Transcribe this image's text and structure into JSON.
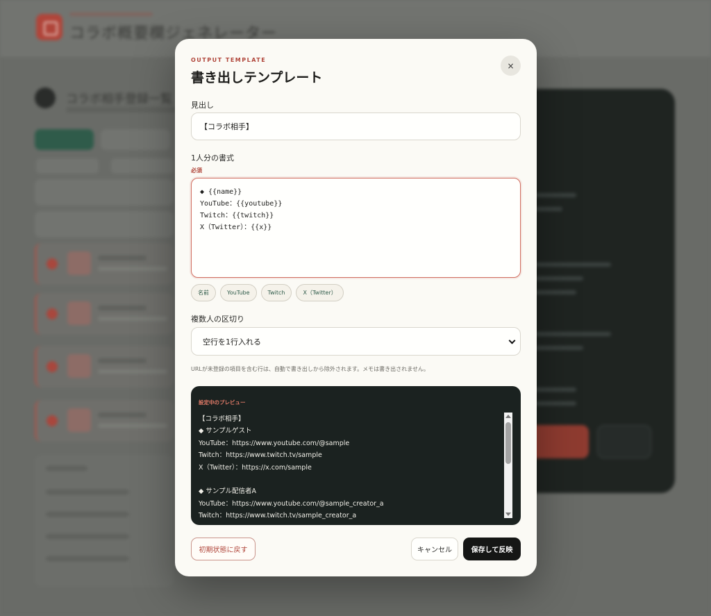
{
  "background": {
    "app_title": "コラボ概要欄ジェネレーター",
    "list_title": "コラボ相手登録一覧"
  },
  "modal": {
    "eyebrow": "OUTPUT TEMPLATE",
    "title": "書き出しテンプレート",
    "close_icon": "×",
    "heading": {
      "label": "見出し",
      "value": "【コラボ相手】"
    },
    "format": {
      "label": "1人分の書式",
      "required": "必須",
      "value": "◆ {{name}}\nYouTube：{{youtube}}\nTwitch：{{twitch}}\nX（Twitter）：{{x}}"
    },
    "tokens": [
      "名前",
      "YouTube",
      "Twitch",
      "X（Twitter）"
    ],
    "separator": {
      "label": "複数人の区切り",
      "selected": "空行を1行入れる"
    },
    "note": "URLが未登録の項目を含む行は、自動で書き出しから除外されます。メモは書き出されません。",
    "preview": {
      "label": "設定中のプレビュー",
      "text": "【コラボ相手】\n◆ サンプルゲスト\nYouTube：https://www.youtube.com/@sample\nTwitch：https://www.twitch.tv/sample\nX（Twitter）：https://x.com/sample\n\n◆ サンプル配信者A\nYouTube：https://www.youtube.com/@sample_creator_a\nTwitch：https://www.twitch.tv/sample_creator_a"
    },
    "buttons": {
      "reset": "初期状態に戻す",
      "cancel": "キャンセル",
      "save": "保存して反映"
    }
  },
  "colors": {
    "accent": "#b0453a",
    "token_text": "#2f5b4a",
    "preview_bg": "#1b2220",
    "save_bg": "#151615"
  }
}
